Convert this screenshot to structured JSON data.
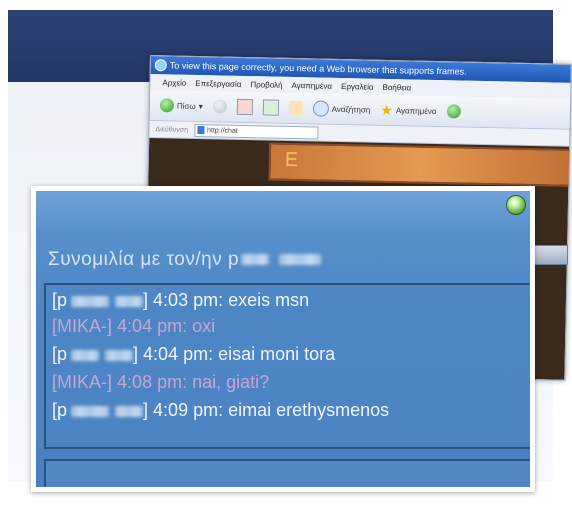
{
  "browser": {
    "title": "To view this page correctly, you need a Web browser that supports frames.",
    "menu": [
      "Αρχείο",
      "Επεξεργασία",
      "Προβολή",
      "Αγαπημένα",
      "Εργαλεία",
      "Βοήθεια"
    ],
    "toolbar": {
      "back_label": "Πίσω",
      "search_label": "Αναζήτηση",
      "favorites_label": "Αγαπημένα"
    },
    "address": {
      "label": "Διεύθυνση",
      "value": "http://chat"
    },
    "content_banner_text": "Ε"
  },
  "chat": {
    "title_prefix": "Συνομιλία με τον/ην p",
    "messages": [
      {
        "sender": "p",
        "time": "4:03 pm:",
        "text": "exeis  msn",
        "self": false
      },
      {
        "sender": "MIKA-",
        "time": "4:04 pm:",
        "text": "oxi",
        "self": true
      },
      {
        "sender": "p",
        "time": "4:04 pm:",
        "text": "eisai moni tora",
        "self": false
      },
      {
        "sender": "MIKA-",
        "time": "4:08 pm:",
        "text": "nai, giati?",
        "self": true
      },
      {
        "sender": "p",
        "time": "4:09 pm:",
        "text": "eimai erethysmenos",
        "self": false
      }
    ],
    "colors": {
      "peer_text": "#eef5fc",
      "self_text": "#c6a6d8",
      "window": "#4c86c6"
    }
  }
}
